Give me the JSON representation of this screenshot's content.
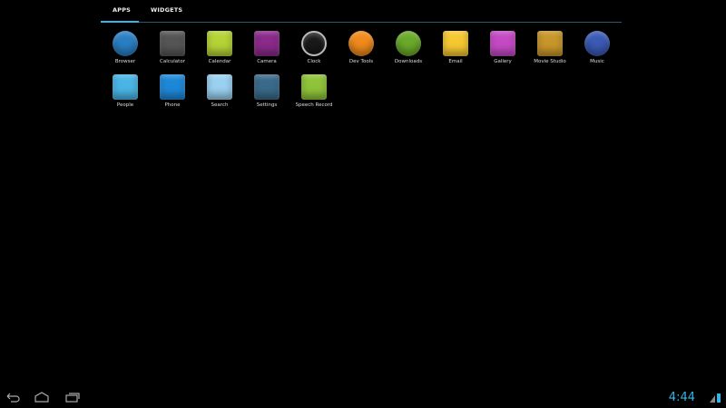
{
  "tabs": [
    {
      "label": "APPS",
      "selected": true
    },
    {
      "label": "WIDGETS",
      "selected": false
    }
  ],
  "apps": [
    {
      "label": "Browser",
      "icon": "globe-icon",
      "color": "#2a7fc4"
    },
    {
      "label": "Calculator",
      "icon": "calculator-icon",
      "color": "#555"
    },
    {
      "label": "Calendar",
      "icon": "calendar-icon",
      "color": "#b5d336"
    },
    {
      "label": "Camera",
      "icon": "camera-icon",
      "color": "#8a2a8a"
    },
    {
      "label": "Clock",
      "icon": "clock-icon",
      "color": "#33b5e5"
    },
    {
      "label": "Dev Tools",
      "icon": "gear-icon",
      "color": "#f08a1c"
    },
    {
      "label": "Downloads",
      "icon": "download-icon",
      "color": "#6aaa2a"
    },
    {
      "label": "Email",
      "icon": "envelope-icon",
      "color": "#f5c832"
    },
    {
      "label": "Gallery",
      "icon": "gallery-icon",
      "color": "#c44ac4"
    },
    {
      "label": "Movie Studio",
      "icon": "clapper-icon",
      "color": "#c8962a"
    },
    {
      "label": "Music",
      "icon": "speaker-icon",
      "color": "#3a5ab5"
    },
    {
      "label": "People",
      "icon": "contact-icon",
      "color": "#4ab5e5"
    },
    {
      "label": "Phone",
      "icon": "phone-icon",
      "color": "#1e88d8"
    },
    {
      "label": "Search",
      "icon": "magnifier-icon",
      "color": "#9ad0f0"
    },
    {
      "label": "Settings",
      "icon": "sliders-icon",
      "color": "#3a6a8a"
    },
    {
      "label": "Speech Record",
      "icon": "android-icon",
      "color": "#8fc33a"
    }
  ],
  "status": {
    "time": "4:44"
  }
}
